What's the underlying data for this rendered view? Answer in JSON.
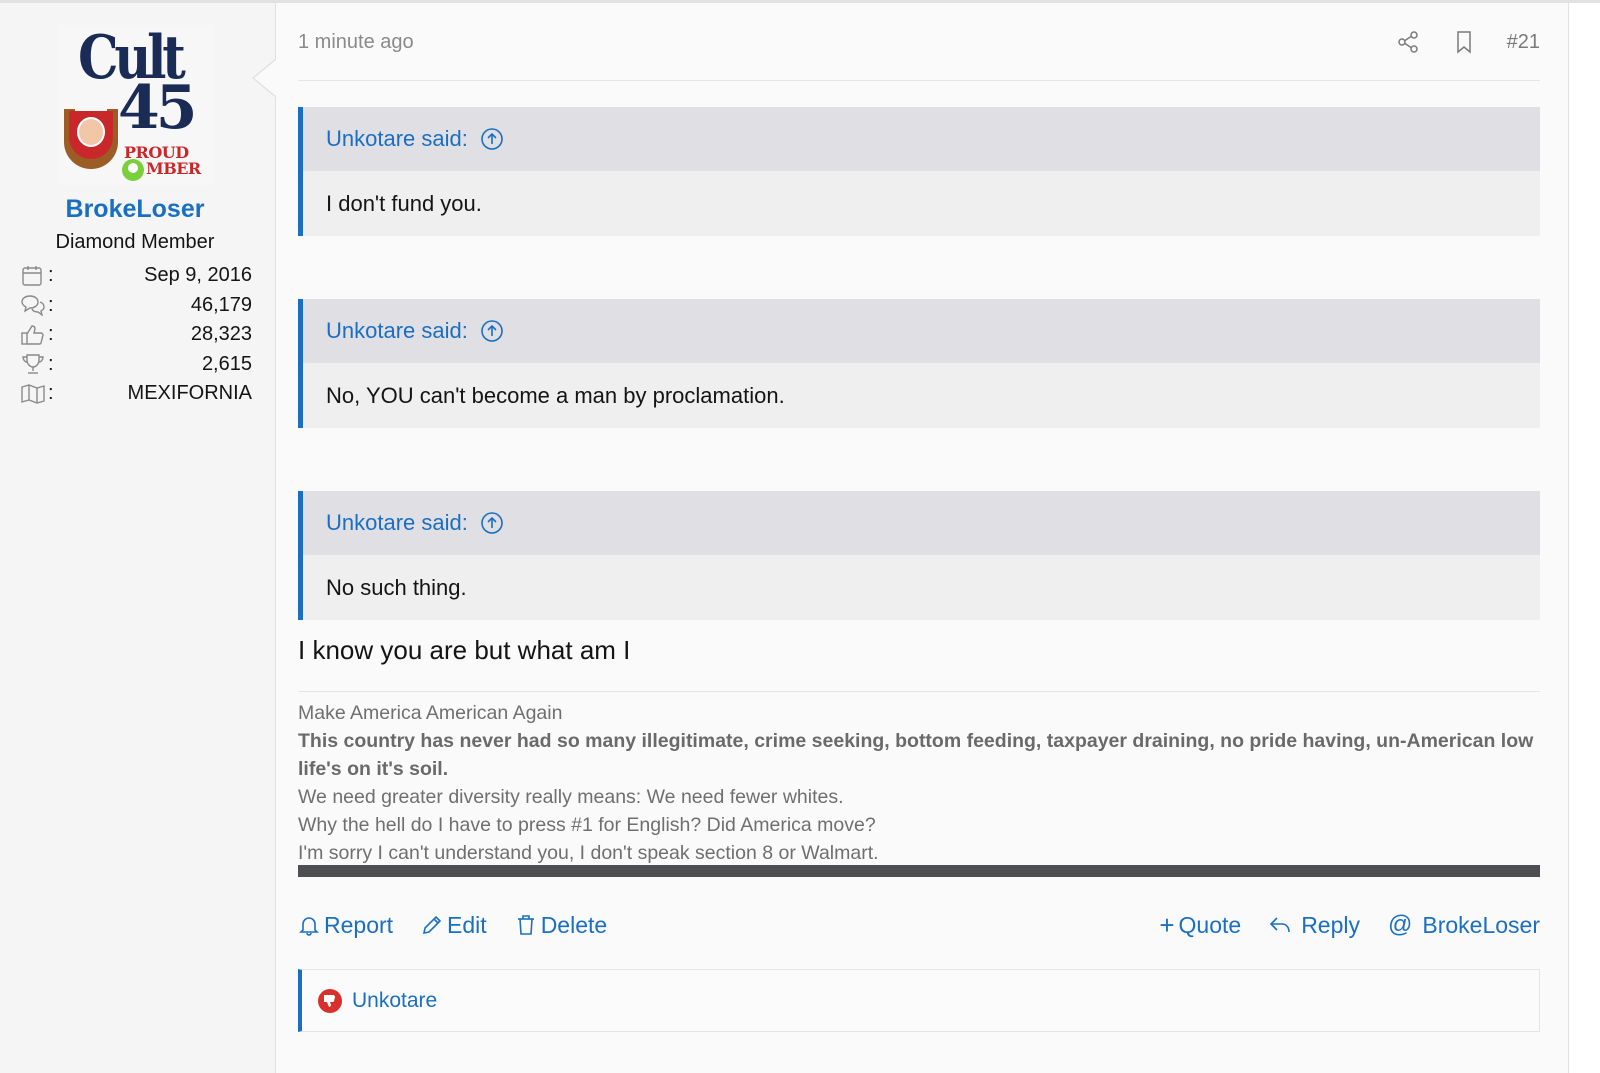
{
  "post": {
    "time": "1 minute ago",
    "number": "#21",
    "message": "I know you are but what am I"
  },
  "user": {
    "avatar_text": {
      "line1": "Cult",
      "line2": "45",
      "line3": "PROUD",
      "line4": "MBER"
    },
    "name": "BrokeLoser",
    "title": "Diamond Member",
    "stats": [
      {
        "icon": "calendar-icon",
        "value": "Sep 9, 2016"
      },
      {
        "icon": "messages-icon",
        "value": "46,179"
      },
      {
        "icon": "thumbs-up-icon",
        "value": "28,323"
      },
      {
        "icon": "trophy-icon",
        "value": "2,615"
      },
      {
        "icon": "map-icon",
        "value": "MEXIFORNIA"
      }
    ]
  },
  "quotes": [
    {
      "author": "Unkotare said:",
      "text": "I don't fund you."
    },
    {
      "author": "Unkotare said:",
      "text": "No, YOU can't become a man by proclamation."
    },
    {
      "author": "Unkotare said:",
      "text": "No such thing."
    }
  ],
  "signature": {
    "line1": "Make America American Again",
    "line2": "This country has never had so many illegitimate, crime seeking, bottom feeding, taxpayer draining, no pride having, un-American low life's on it's soil.",
    "line3": "We need greater diversity really means: We need fewer whites.",
    "line4": "Why the hell do I have to press #1 for English? Did America move?",
    "line5": "I'm sorry I can't understand you, I don't speak section 8 or Walmart."
  },
  "footer": {
    "report": "Report",
    "edit": "Edit",
    "delete": "Delete",
    "quote": "Quote",
    "reply": "Reply",
    "mention": "BrokeLoser"
  },
  "reactions": {
    "user": "Unkotare",
    "icon": "thumbs-down-icon"
  },
  "colors": {
    "link": "#1a6fc2",
    "quote_bar": "#1a6fc2",
    "reaction": "#d9302c"
  }
}
